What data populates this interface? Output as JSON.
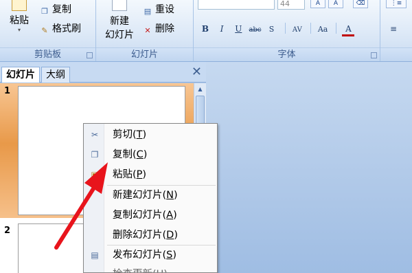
{
  "ribbon": {
    "clipboard": {
      "caption": "剪贴板",
      "paste_label": "粘贴",
      "copy_label": "复制",
      "format_painter_label": "格式刷"
    },
    "slides": {
      "caption": "幻灯片",
      "new_slide_line1": "新建",
      "new_slide_line2": "幻灯片",
      "reset_label": "重设",
      "delete_label": "删除"
    },
    "font": {
      "caption": "字体",
      "size_value": "44",
      "bold": "B",
      "italic": "I",
      "underline": "U",
      "strike": "abc",
      "shadow": "S",
      "spacing": "AV",
      "case": "Aa",
      "color": "A"
    }
  },
  "pane": {
    "tab_slides": "幻灯片",
    "tab_outline": "大纲",
    "close_glyph": "✕",
    "thumbnails": [
      {
        "number": "1"
      },
      {
        "number": "2"
      }
    ]
  },
  "context_menu": {
    "items": [
      {
        "label": "剪切",
        "key": "T",
        "icon": "scissors-icon"
      },
      {
        "label": "复制",
        "key": "C",
        "icon": "copy-icon"
      },
      {
        "label": "粘贴",
        "key": "P",
        "icon": "paste-icon"
      },
      {
        "label": "新建幻灯片",
        "key": "N",
        "icon": ""
      },
      {
        "label": "复制幻灯片",
        "key": "A",
        "icon": ""
      },
      {
        "label": "删除幻灯片",
        "key": "D",
        "icon": ""
      },
      {
        "label": "发布幻灯片",
        "key": "S",
        "icon": "publish-icon"
      }
    ],
    "partial_item": "检查更新(U)"
  },
  "colors": {
    "selection": "#e89949",
    "annotation_arrow": "#e8141c",
    "ribbon_text": "#15428b"
  }
}
